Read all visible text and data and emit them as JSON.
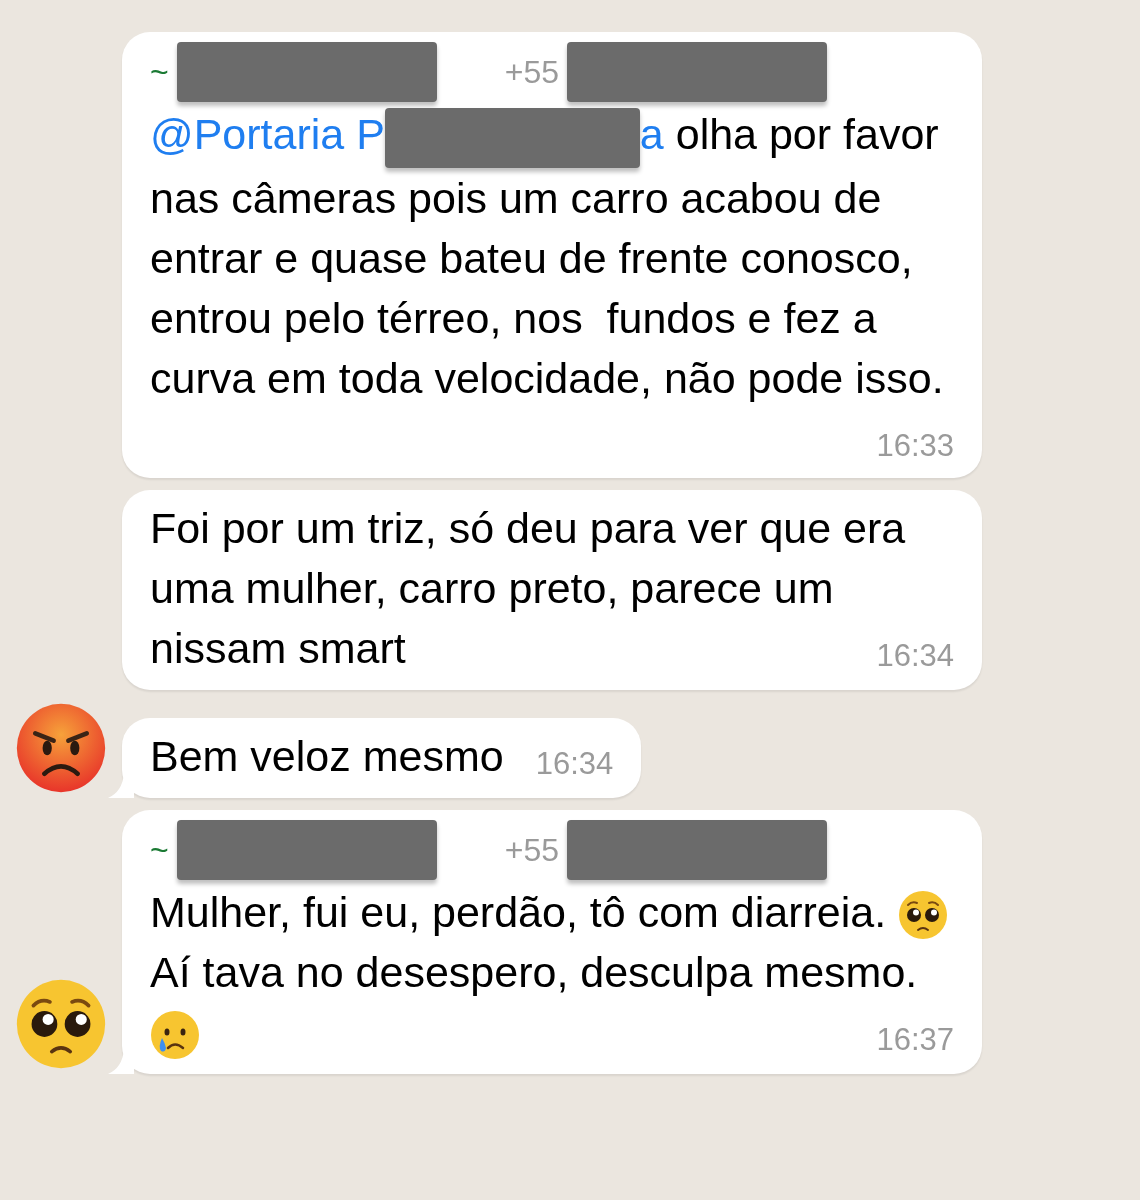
{
  "messages": [
    {
      "sender": {
        "prefix": "~",
        "phone": "+55"
      },
      "paragraphs": [
        [
          {
            "kind": "mention",
            "text": "@Portaria P"
          },
          {
            "kind": "redaction"
          },
          {
            "kind": "mention",
            "text": "a"
          },
          {
            "kind": "text",
            "text": " olha por favor nas câmeras pois um carro acabou de entrar e quase bateu de frente conosco, entrou pelo térreo, nos  fundos e fez a curva em toda velocidade, não pode isso."
          }
        ]
      ],
      "time": "16:33",
      "tail": false
    },
    {
      "paragraphs": [
        [
          {
            "kind": "text",
            "text": "Foi por um triz, só deu para ver que era uma mulher, carro preto, parece um nissam smart"
          }
        ]
      ],
      "time": "16:34",
      "tail": false
    },
    {
      "paragraphs": [
        [
          {
            "kind": "text",
            "text": "Bem veloz mesmo"
          }
        ]
      ],
      "time": "16:34",
      "tail": true,
      "avatar": {
        "kind": "angry"
      }
    },
    {
      "sender": {
        "prefix": "~",
        "phone": "+55"
      },
      "paragraphs": [
        [
          {
            "kind": "text",
            "text": "Mulher, fui eu, perdão, tô com diarreia. "
          },
          {
            "kind": "pleading"
          }
        ],
        [
          {
            "kind": "text",
            "text": "Aí tava no desespero, desculpa mesmo. "
          },
          {
            "kind": "crying"
          }
        ]
      ],
      "time": "16:37",
      "tail": true,
      "avatar": {
        "kind": "pleading"
      }
    }
  ]
}
